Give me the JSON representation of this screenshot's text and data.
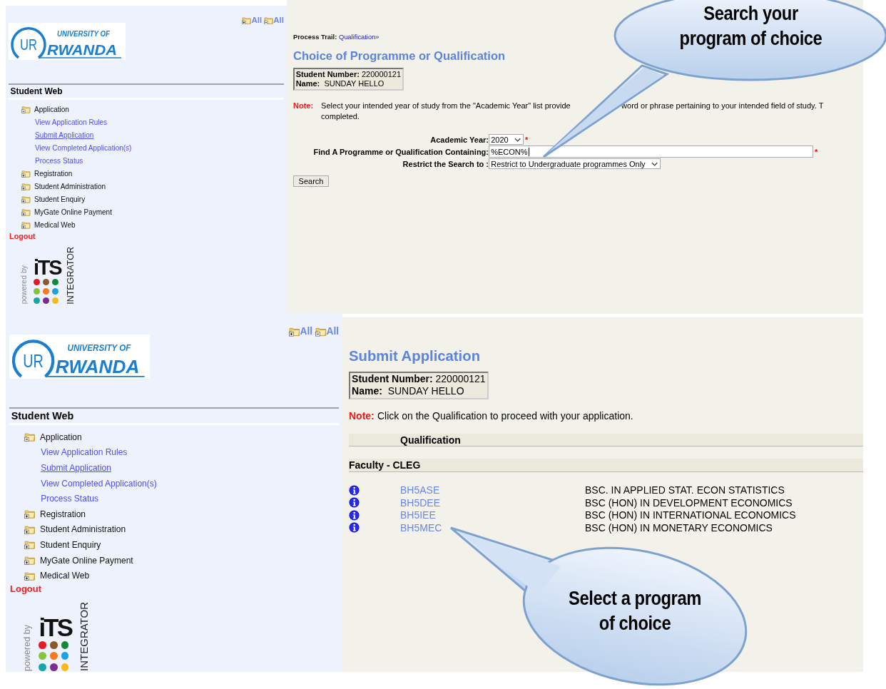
{
  "panels": [
    {
      "sidebar": {
        "logo": {
          "mark": "UR",
          "line1": "UNIVERSITY OF",
          "line2": "RWANDA"
        },
        "toggle_buttons": [
          {
            "kind": "expand",
            "label": "All"
          },
          {
            "kind": "collapse",
            "label": "All"
          }
        ],
        "section_title": "Student Web",
        "menu": [
          {
            "label": "Application",
            "expanded": true,
            "children": [
              {
                "label": "View Application Rules",
                "selected": false
              },
              {
                "label": "Submit Application",
                "selected": true
              },
              {
                "label": "View Completed Application(s)",
                "selected": false
              },
              {
                "label": "Process Status",
                "selected": false
              }
            ]
          },
          {
            "label": "Registration",
            "expanded": false
          },
          {
            "label": "Student Administration",
            "expanded": false
          },
          {
            "label": "Student Enquiry",
            "expanded": false
          },
          {
            "label": "MyGate Online Payment",
            "expanded": false
          },
          {
            "label": "Medical Web",
            "expanded": false
          }
        ],
        "logout": "Logout",
        "footer": {
          "powered_by": "powered by",
          "brand": "iTS",
          "product": "INTEGRATOR"
        }
      },
      "content": {
        "kind": "search",
        "process_trail": {
          "label": "Process Trail:",
          "link": "Qualification»"
        },
        "title": "Choice of Programme or Qualification",
        "student": {
          "number_label": "Student Number:",
          "number": "220000121",
          "name_label": "Name:",
          "name": "SUNDAY HELLO"
        },
        "note": {
          "label": "Note:",
          "fragments": [
            "Select your intended year of study from the \"Academic Year\" list provide",
            "word or phrase pertaining to your intended field of study. T",
            "completed."
          ]
        },
        "fields": [
          {
            "kind": "select",
            "label": "Academic Year:",
            "value": "2020",
            "required_mark": "*"
          },
          {
            "kind": "text",
            "label": "Find A Programme or Qualification Containing:",
            "value": "%ECON%",
            "required_mark": "*"
          },
          {
            "kind": "select",
            "label": "Restrict the Search to :",
            "value": "Restrict to Undergraduate programmes Only"
          }
        ],
        "button": "Search"
      }
    },
    {
      "sidebar": {
        "logo": {
          "mark": "UR",
          "line1": "UNIVERSITY OF",
          "line2": "RWANDA"
        },
        "toggle_buttons": [
          {
            "kind": "expand",
            "label": "All"
          },
          {
            "kind": "collapse",
            "label": "All"
          }
        ],
        "section_title": "Student Web",
        "menu": [
          {
            "label": "Application",
            "expanded": true,
            "children": [
              {
                "label": "View Application Rules",
                "selected": false
              },
              {
                "label": "Submit Application",
                "selected": true
              },
              {
                "label": "View Completed Application(s)",
                "selected": false
              },
              {
                "label": "Process Status",
                "selected": false
              }
            ]
          },
          {
            "label": "Registration",
            "expanded": false
          },
          {
            "label": "Student Administration",
            "expanded": false
          },
          {
            "label": "Student Enquiry",
            "expanded": false
          },
          {
            "label": "MyGate Online Payment",
            "expanded": false
          },
          {
            "label": "Medical Web",
            "expanded": false
          }
        ],
        "logout": "Logout",
        "footer": {
          "powered_by": "powered by",
          "brand": "iTS",
          "product": "INTEGRATOR"
        }
      },
      "content": {
        "kind": "results",
        "title": "Submit Application",
        "student": {
          "number_label": "Student Number:",
          "number": "220000121",
          "name_label": "Name:",
          "name": "SUNDAY HELLO"
        },
        "note": {
          "label": "Note:",
          "text": "Click on the Qualification to proceed with your application."
        },
        "table": {
          "header": "Qualification",
          "group": "Faculty - CLEG",
          "rows": [
            {
              "code": "BH5ASE",
              "title": "BSC. IN APPLIED STAT. ECON STATISTICS"
            },
            {
              "code": "BH5DEE",
              "title": "BSC (HON) IN DEVELOPMENT ECONOMICS"
            },
            {
              "code": "BH5IEE",
              "title": "BSC (HON) IN INTERNATIONAL ECONOMICS"
            },
            {
              "code": "BH5MEC",
              "title": "BSC (HON) IN MONETARY ECONOMICS"
            }
          ]
        }
      }
    }
  ],
  "callouts": [
    {
      "lines": [
        "Search your",
        "program of choice"
      ]
    },
    {
      "lines": [
        "Select a program",
        "of choice"
      ]
    }
  ]
}
